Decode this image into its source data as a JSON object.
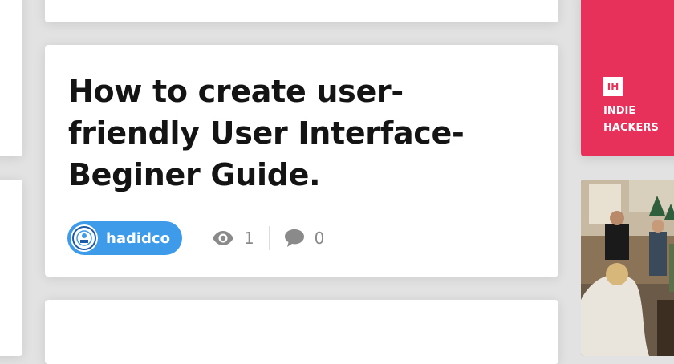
{
  "post": {
    "title": "How to create user-friendly User Interface- Beginer Guide.",
    "author": "hadidco",
    "views": "1",
    "comments": "0"
  },
  "icons": {
    "views": "eye-icon",
    "comments": "comment-icon"
  },
  "sponsor": {
    "logo": "IH",
    "name": "INDIE\nHACKERS",
    "color": "#e8315a"
  },
  "colors": {
    "author_pill": "#3d9be9"
  }
}
